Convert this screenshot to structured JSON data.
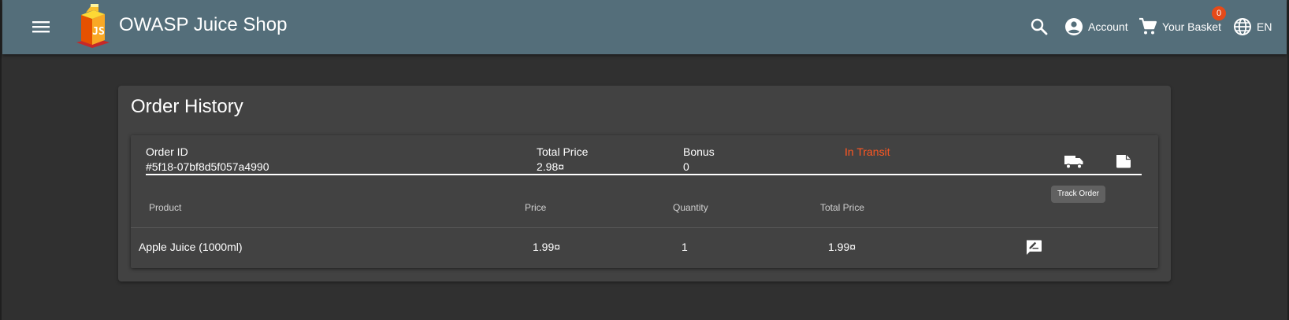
{
  "app": {
    "title": "OWASP Juice Shop"
  },
  "toolbar": {
    "menu_icon": "hamburger-menu-icon",
    "search_icon": "search-icon",
    "account_label": "Account",
    "basket_label": "Your Basket",
    "basket_count": "0",
    "language_label": "EN",
    "colors": {
      "toolbar_bg": "#546e7a",
      "badge_bg": "#e64a19"
    }
  },
  "page": {
    "title": "Order History"
  },
  "order": {
    "id_label": "Order ID",
    "id_value": "#5f18-07bf8d5f057a4990",
    "total_label": "Total Price",
    "total_value": "2.98¤",
    "bonus_label": "Bonus",
    "bonus_value": "0",
    "status": "In Transit",
    "status_color": "#ff5722",
    "track_icon": "truck-icon",
    "receipt_icon": "receipt-icon",
    "track_tooltip": "Track Order"
  },
  "table": {
    "headers": [
      "Product",
      "Price",
      "Quantity",
      "Total Price"
    ],
    "rows": [
      {
        "product": "Apple Juice (1000ml)",
        "price": "1.99¤",
        "quantity": "1",
        "total": "1.99¤",
        "review_icon": "rate-review-icon"
      }
    ]
  }
}
